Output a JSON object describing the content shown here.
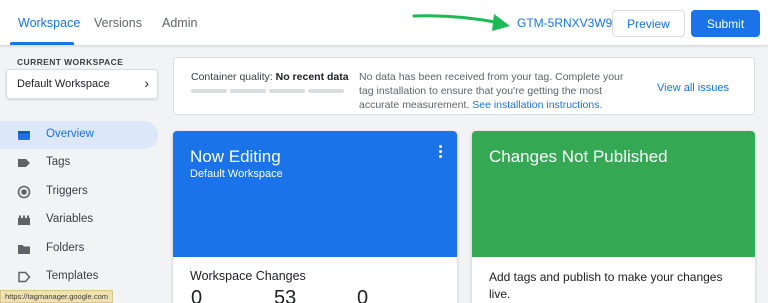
{
  "topbar": {
    "tabs": [
      {
        "label": "Workspace",
        "active": true
      },
      {
        "label": "Versions",
        "active": false
      },
      {
        "label": "Admin",
        "active": false
      }
    ],
    "container_id": "GTM-5RNXV3W9",
    "preview_label": "Preview",
    "submit_label": "Submit"
  },
  "sidebar": {
    "current_workspace_label": "CURRENT WORKSPACE",
    "workspace_name": "Default Workspace",
    "items": [
      {
        "label": "Overview",
        "icon": "overview-icon",
        "active": true
      },
      {
        "label": "Tags",
        "icon": "tag-icon",
        "active": false
      },
      {
        "label": "Triggers",
        "icon": "trigger-icon",
        "active": false
      },
      {
        "label": "Variables",
        "icon": "variables-icon",
        "active": false
      },
      {
        "label": "Folders",
        "icon": "folder-icon",
        "active": false
      },
      {
        "label": "Templates",
        "icon": "template-icon",
        "active": false
      }
    ]
  },
  "quality": {
    "label": "Container quality:",
    "status": "No recent data",
    "message": "No data has been received from your tag. Complete your tag installation to ensure that you're getting the most accurate measurement.",
    "link": "See installation instructions.",
    "view_all": "View all issues"
  },
  "now_editing": {
    "title": "Now Editing",
    "workspace": "Default Workspace",
    "body_title": "Workspace Changes",
    "stats": [
      "0",
      "53",
      "0"
    ]
  },
  "changes": {
    "title": "Changes Not Published",
    "body": "Add tags and publish to make your changes live."
  },
  "status_url": "https://tagmanager.google.com",
  "colors": {
    "accent": "#1a73e8",
    "now_editing_bg": "#1a73e8",
    "changes_bg": "#34a853",
    "arrow": "#1db954"
  }
}
